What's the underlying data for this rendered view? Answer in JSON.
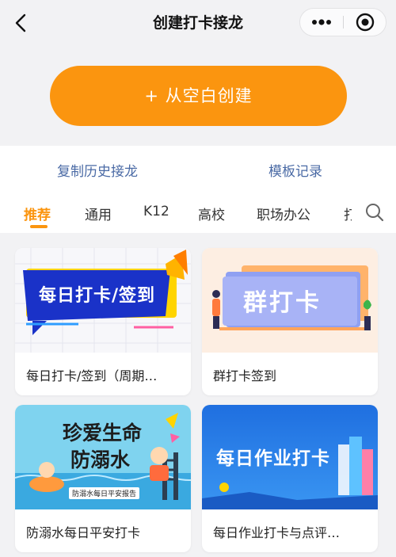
{
  "header": {
    "title": "创建打卡接龙"
  },
  "create": {
    "label": "+ 从空白创建"
  },
  "links": {
    "copy_history": "复制历史接龙",
    "template_records": "模板记录"
  },
  "tabs": [
    {
      "label": "推荐",
      "active": true
    },
    {
      "label": "通用",
      "active": false
    },
    {
      "label": "K12",
      "active": false
    },
    {
      "label": "高校",
      "active": false
    },
    {
      "label": "职场办公",
      "active": false
    },
    {
      "label": "打",
      "active": false
    }
  ],
  "cards": [
    {
      "name": "每日打卡/签到（周期…",
      "banner": "每日打卡/签到"
    },
    {
      "name": "群打卡签到",
      "banner": "群打卡"
    },
    {
      "name": "防溺水每日平安打卡",
      "banner_top": "珍爱生命",
      "banner_mid": "防溺水",
      "banner_small": "防溺水每日平安报告"
    },
    {
      "name": "每日作业打卡与点评…",
      "banner": "每日作业打卡"
    }
  ],
  "colors": {
    "accent": "#fb950f",
    "link": "#4a6aa5"
  }
}
